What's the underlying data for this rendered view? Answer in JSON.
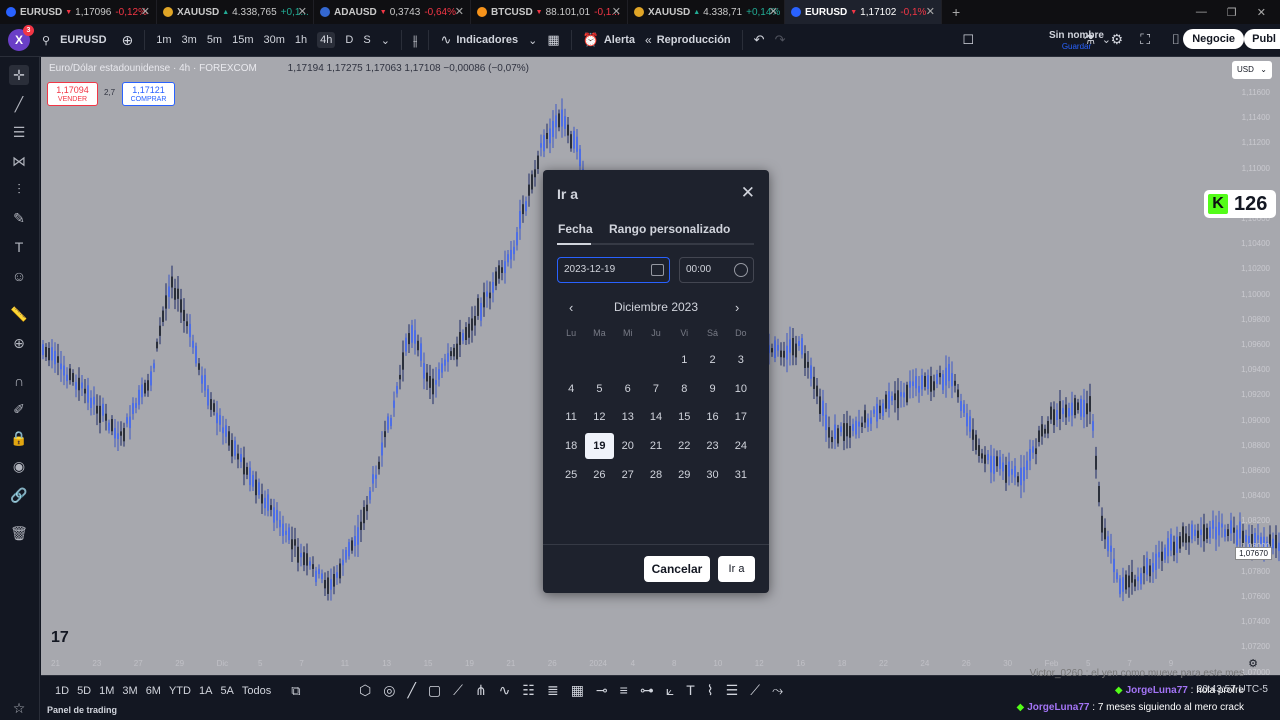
{
  "browser_tabs": [
    {
      "symbol": "EURUSD",
      "price": "1,17096",
      "change": "-0,12%",
      "dir": "down",
      "icon_color": "#2962ff"
    },
    {
      "symbol": "XAUUSD",
      "price": "4.338,765",
      "change": "+0,1...",
      "dir": "up",
      "icon_color": "#e0a526"
    },
    {
      "symbol": "ADAUSD",
      "price": "0,3743",
      "change": "-0,64%",
      "dir": "down",
      "icon_color": "#3468d1"
    },
    {
      "symbol": "BTCUSD",
      "price": "88.101,01",
      "change": "-0,1...",
      "dir": "down",
      "icon_color": "#f7931a"
    },
    {
      "symbol": "XAUUSD",
      "price": "4.338,71",
      "change": "+0,14%",
      "dir": "up",
      "icon_color": "#e0a526"
    },
    {
      "symbol": "EURUSD",
      "price": "1,17102",
      "change": "-0,1%",
      "dir": "down",
      "icon_color": "#2962ff",
      "active": true
    }
  ],
  "toolbar": {
    "notifications": "3",
    "symbol": "EURUSD",
    "timeframes": [
      "1m",
      "3m",
      "5m",
      "15m",
      "30m",
      "1h",
      "4h",
      "D",
      "S"
    ],
    "active_timeframe": "4h",
    "indicators_label": "Indicadores",
    "alert_label": "Alerta",
    "replay_label": "Reproducción",
    "layout_name": "Sin nombre",
    "layout_saved": "Guardar",
    "trade_label": "Negocie",
    "publish_label": "Publ"
  },
  "chart": {
    "title": "Euro/Dólar estadounidense · 4h · FOREXCOM",
    "ohlc": "1,17194  1,17275  1,17063  1,17108  −0,00086 (−0,07%)",
    "sell_price": "1,17094",
    "sell_label": "VENDER",
    "spread": "2,7",
    "buy_price": "1,17121",
    "buy_label": "COMPRAR",
    "currency": "USD",
    "price_axis": [
      "1,11600",
      "1,11400",
      "1,11200",
      "1,11000",
      "1,10800",
      "1,10600",
      "1,10400",
      "1,10200",
      "1,10000",
      "1,09800",
      "1,09600",
      "1,09400",
      "1,09200",
      "1,09000",
      "1,08800",
      "1,08600",
      "1,08400",
      "1,08200",
      "1,08000",
      "1,07800",
      "1,07600",
      "1,07400",
      "1,07200",
      "1,07000"
    ],
    "current_price": "1,07670",
    "date_axis": [
      "21",
      "23",
      "27",
      "29",
      "Dic",
      "5",
      "7",
      "11",
      "13",
      "15",
      "19",
      "21",
      "26",
      "2024",
      "4",
      "8",
      "10",
      "12",
      "16",
      "18",
      "22",
      "24",
      "26",
      "30",
      "Feb",
      "5",
      "7",
      "9"
    ],
    "kick_count": "126"
  },
  "goto_dialog": {
    "title": "Ir a",
    "tabs": [
      "Fecha",
      "Rango personalizado"
    ],
    "date_value": "2023-12-19",
    "time_value": "00:00",
    "month_label": "Diciembre 2023",
    "weekdays": [
      "Lu",
      "Ma",
      "Mi",
      "Ju",
      "Vi",
      "Sá",
      "Do"
    ],
    "weeks": [
      [
        "",
        "",
        "",
        "",
        "1",
        "2",
        "3"
      ],
      [
        "4",
        "5",
        "6",
        "7",
        "8",
        "9",
        "10"
      ],
      [
        "11",
        "12",
        "13",
        "14",
        "15",
        "16",
        "17"
      ],
      [
        "18",
        "19",
        "20",
        "21",
        "22",
        "23",
        "24"
      ],
      [
        "25",
        "26",
        "27",
        "28",
        "29",
        "30",
        "31"
      ]
    ],
    "selected_day": "19",
    "cancel_label": "Cancelar",
    "go_label": "Ir a"
  },
  "bottom": {
    "ranges": [
      "1D",
      "5D",
      "1M",
      "3M",
      "6M",
      "YTD",
      "1A",
      "5A",
      "Todos"
    ],
    "clock": "20:43:57 UTC-5",
    "footer_text": "Panel de trading"
  },
  "chat": [
    {
      "user": "Victor_0260",
      "message": "el yen como mueve para este mes",
      "faded": true
    },
    {
      "user": "JorgeLuna77",
      "message": "hola profre"
    },
    {
      "user": "JorgeLuna77",
      "message": "7 meses siguiendo al mero crack"
    }
  ]
}
